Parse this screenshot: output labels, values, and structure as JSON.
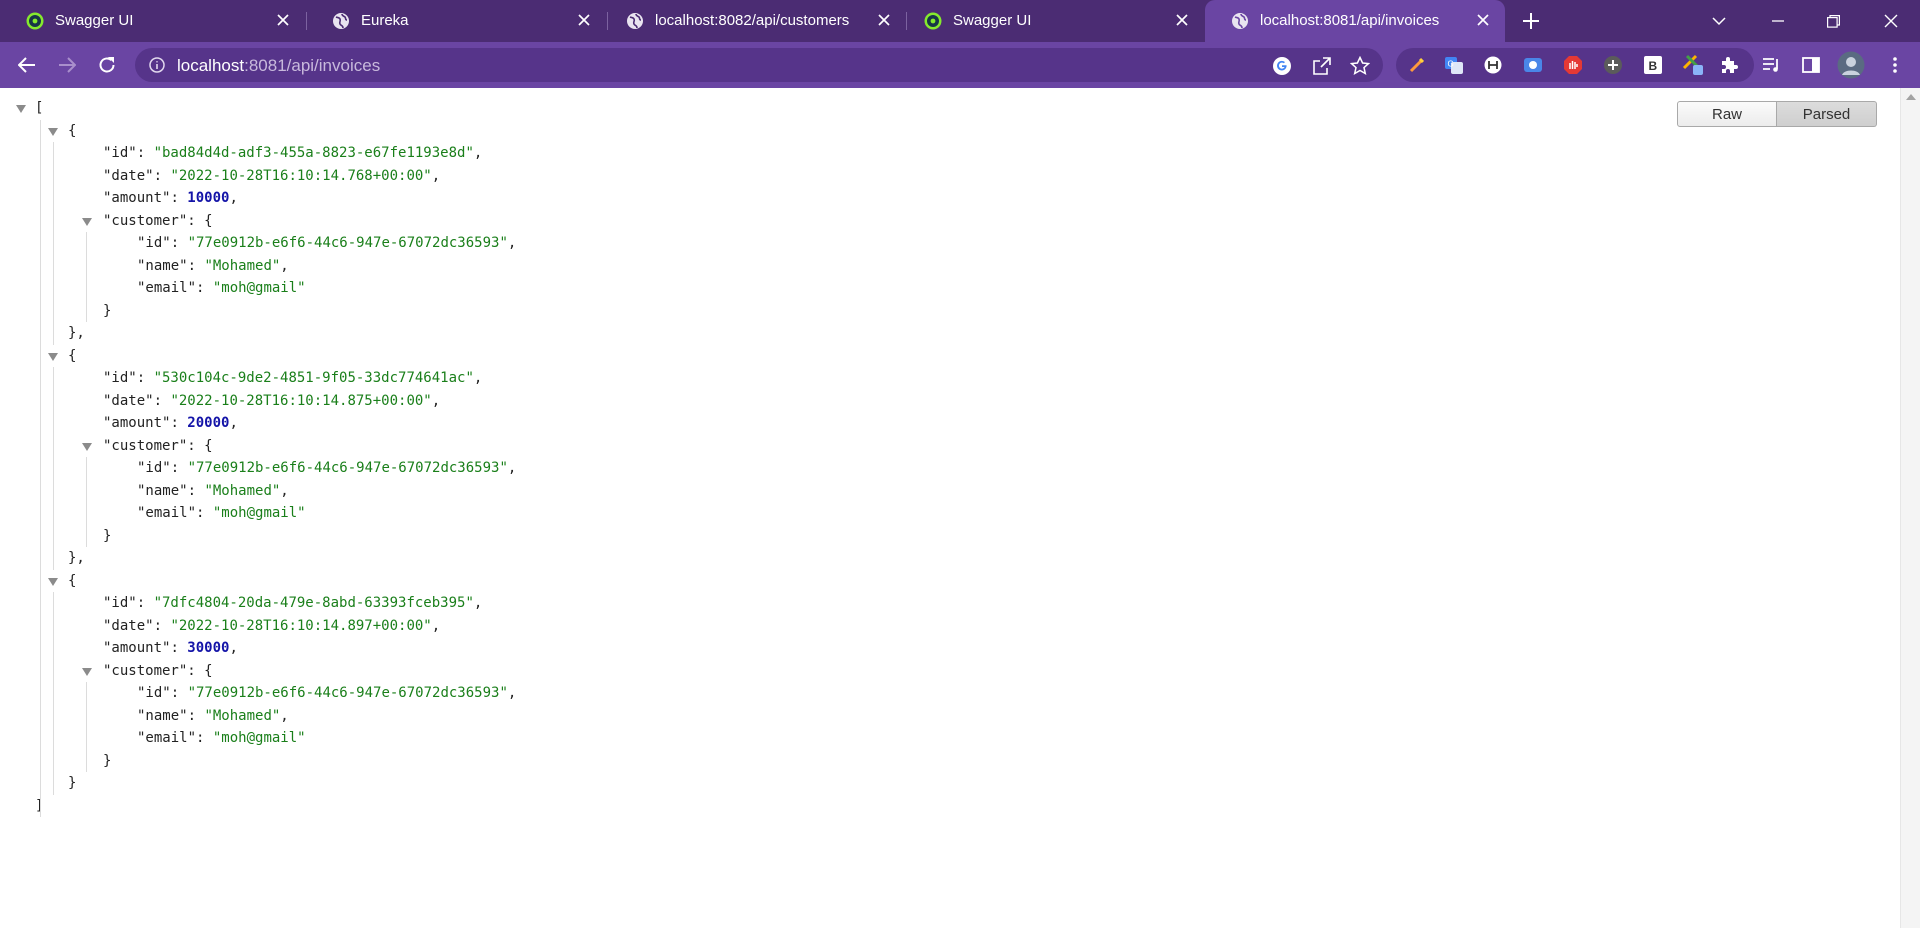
{
  "browser": {
    "tabs": [
      {
        "title": "Swagger UI",
        "icon": "swagger-icon",
        "active": false
      },
      {
        "title": "Eureka",
        "icon": "globe-icon",
        "active": false
      },
      {
        "title": "localhost:8082/api/customers",
        "icon": "globe-icon",
        "active": false
      },
      {
        "title": "Swagger UI",
        "icon": "swagger-icon",
        "active": false
      },
      {
        "title": "localhost:8081/api/invoices",
        "icon": "globe-icon",
        "active": true
      }
    ],
    "address": {
      "host": "localhost",
      "rest": ":8081/api/invoices"
    },
    "colors": {
      "frame": "#4b2c73",
      "toolbar": "#6a45a3",
      "omnibox": "#56348a"
    }
  },
  "viewer": {
    "raw_label": "Raw",
    "parsed_label": "Parsed",
    "invoices": [
      {
        "id": "\"bad84d4d-adf3-455a-8823-e67fe1193e8d\"",
        "date": "\"2022-10-28T16:10:14.768+00:00\"",
        "amount": "10000",
        "customer": {
          "id": "\"77e0912b-e6f6-44c6-947e-67072dc36593\"",
          "name": "\"Mohamed\"",
          "email": "\"moh@gmail\""
        }
      },
      {
        "id": "\"530c104c-9de2-4851-9f05-33dc774641ac\"",
        "date": "\"2022-10-28T16:10:14.875+00:00\"",
        "amount": "20000",
        "customer": {
          "id": "\"77e0912b-e6f6-44c6-947e-67072dc36593\"",
          "name": "\"Mohamed\"",
          "email": "\"moh@gmail\""
        }
      },
      {
        "id": "\"7dfc4804-20da-479e-8abd-63393fceb395\"",
        "date": "\"2022-10-28T16:10:14.897+00:00\"",
        "amount": "30000",
        "customer": {
          "id": "\"77e0912b-e6f6-44c6-947e-67072dc36593\"",
          "name": "\"Mohamed\"",
          "email": "\"moh@gmail\""
        }
      }
    ],
    "keys": {
      "id": "\"id\"",
      "date": "\"date\"",
      "amount": "\"amount\"",
      "customer": "\"customer\"",
      "name": "\"name\"",
      "email": "\"email\""
    },
    "punct": {
      "open_bracket": "[",
      "close_bracket": "]",
      "open_brace": "{",
      "close_brace": "}",
      "close_brace_comma": "},",
      "colon": ": ",
      "comma": ","
    }
  }
}
